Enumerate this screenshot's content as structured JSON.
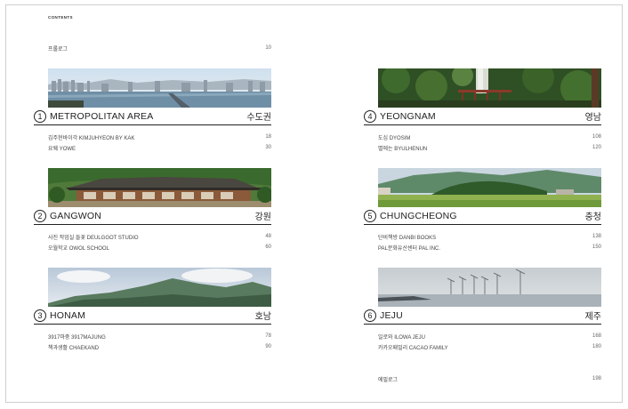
{
  "contents_label": "CONTENTS",
  "prologue": {
    "title": "프롤로그",
    "page": "10"
  },
  "epilogue": {
    "title": "에필로그",
    "page": "198"
  },
  "sections": [
    {
      "number": "1",
      "name": "METROPOLITAN AREA",
      "korean": "수도권",
      "photo": "city-skyline-photo",
      "entries": [
        {
          "title": "김주현바이각 KIMJUHYEON BY KAK",
          "page": "18"
        },
        {
          "title": "요웨 YOWE",
          "page": "30"
        }
      ]
    },
    {
      "number": "2",
      "name": "GANGWON",
      "korean": "강원",
      "photo": "hanok-village-photo",
      "entries": [
        {
          "title": "사진 작업실 들꽃 DEULGGOT STUDIO",
          "page": "48"
        },
        {
          "title": "오월학교 OWOL SCHOOL",
          "page": "60"
        }
      ]
    },
    {
      "number": "3",
      "name": "HONAM",
      "korean": "호남",
      "photo": "mountain-landscape-photo",
      "entries": [
        {
          "title": "3917마중 3917MAJUNG",
          "page": "78"
        },
        {
          "title": "책과생활 CHAEKAND",
          "page": "90"
        }
      ]
    },
    {
      "number": "4",
      "name": "YEONGNAM",
      "korean": "영남",
      "photo": "forest-bridge-photo",
      "entries": [
        {
          "title": "도심 DYOSIM",
          "page": "108"
        },
        {
          "title": "별에는 BYULHENUN",
          "page": "120"
        }
      ]
    },
    {
      "number": "5",
      "name": "CHUNGCHEONG",
      "korean": "충청",
      "photo": "green-hill-field-photo",
      "entries": [
        {
          "title": "단비책방 DANBI BOOKS",
          "page": "138"
        },
        {
          "title": "PAL문화유산센터 PAL INC.",
          "page": "150"
        }
      ]
    },
    {
      "number": "6",
      "name": "JEJU",
      "korean": "제주",
      "photo": "wind-turbines-sea-photo",
      "entries": [
        {
          "title": "일로와 ILOWA JEJU",
          "page": "168"
        },
        {
          "title": "카카오패밀리 CACAO FAMILY",
          "page": "180"
        }
      ]
    }
  ]
}
